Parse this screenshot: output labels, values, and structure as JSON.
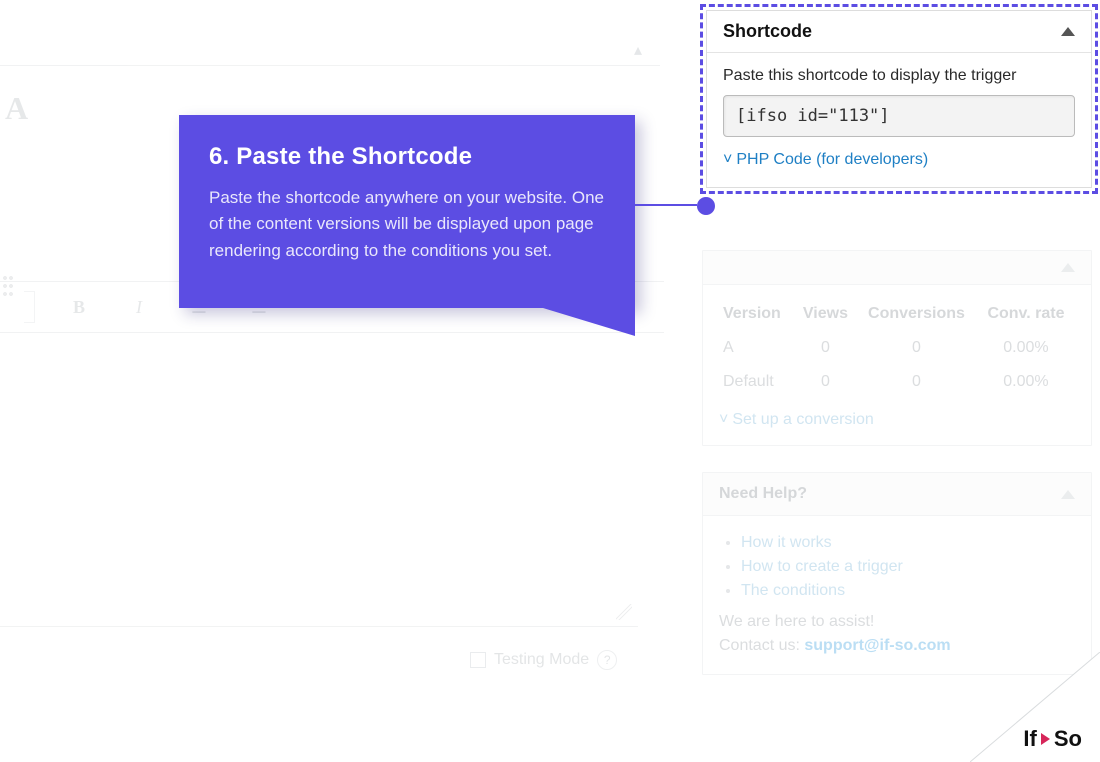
{
  "callout": {
    "title": "6. Paste the Shortcode",
    "body": "Paste the shortcode anywhere on your website. One of the content versions will be displayed upon page rendering according to the conditions you set."
  },
  "shortcode": {
    "panel_title": "Shortcode",
    "instruction": "Paste this shortcode to display the trigger",
    "code": "[ifso id=\"113\"]",
    "php_link": "PHP Code (for developers)"
  },
  "stats": {
    "columns": [
      "Version",
      "Views",
      "Conversions",
      "Conv. rate"
    ],
    "rows": [
      {
        "version": "A",
        "views": "0",
        "conversions": "0",
        "rate": "0.00%"
      },
      {
        "version": "Default",
        "views": "0",
        "conversions": "0",
        "rate": "0.00%"
      }
    ],
    "setup_link": "Set up a conversion"
  },
  "help": {
    "title": "Need Help?",
    "links": [
      "How it works",
      "How to create a trigger",
      "The conditions"
    ],
    "assist_text": "We are here to assist!",
    "contact_prefix": "Contact us: ",
    "contact_email": "support@if-so.com"
  },
  "editor": {
    "version_label": "A",
    "testing_label": "Testing Mode"
  },
  "logo": {
    "part1": "If",
    "part2": "So"
  }
}
